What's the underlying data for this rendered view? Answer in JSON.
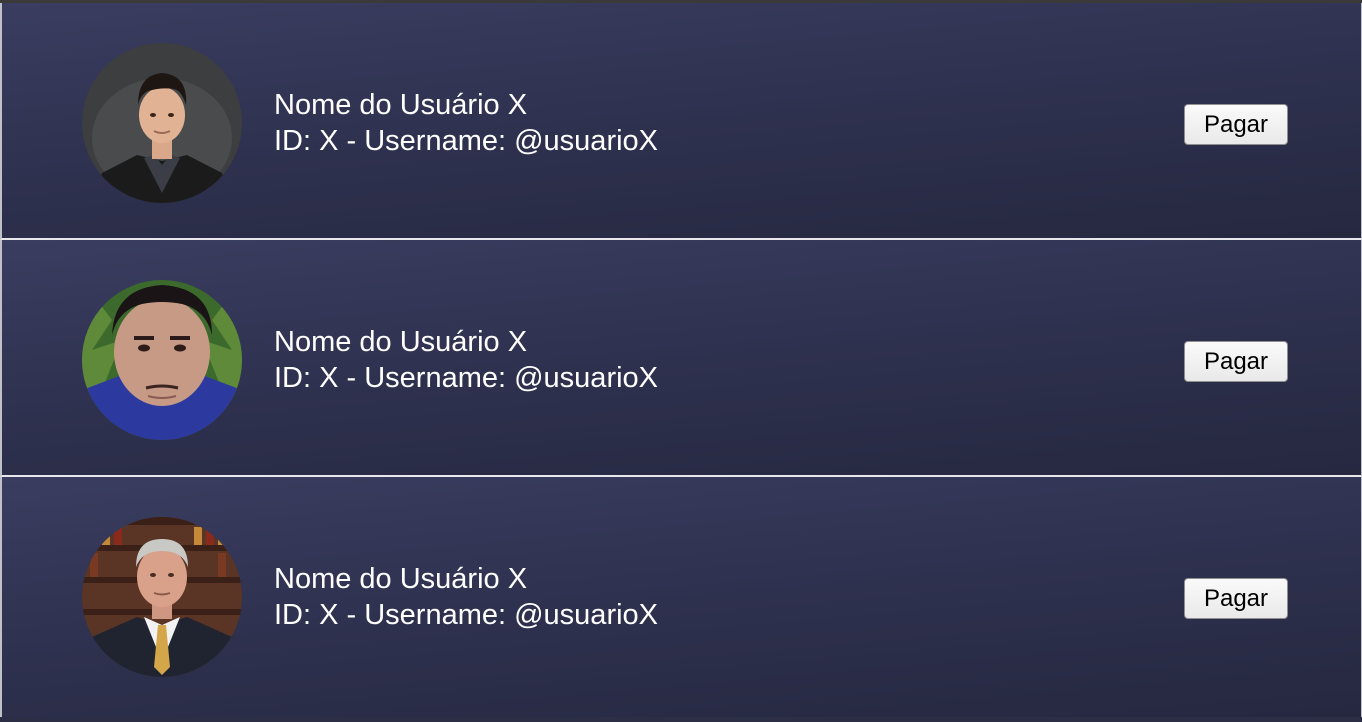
{
  "users": [
    {
      "name": "Nome do Usuário X",
      "details": "ID: X - Username: @usuarioX",
      "pay_label": "Pagar",
      "avatar": "user-photo-1"
    },
    {
      "name": "Nome do Usuário X",
      "details": "ID: X - Username: @usuarioX",
      "pay_label": "Pagar",
      "avatar": "user-photo-2"
    },
    {
      "name": "Nome do Usuário X",
      "details": "ID: X - Username: @usuarioX",
      "pay_label": "Pagar",
      "avatar": "user-photo-3"
    }
  ],
  "colors": {
    "card_background": "#2f3250",
    "text": "#ffffff",
    "separator": "#e8e8ec"
  }
}
